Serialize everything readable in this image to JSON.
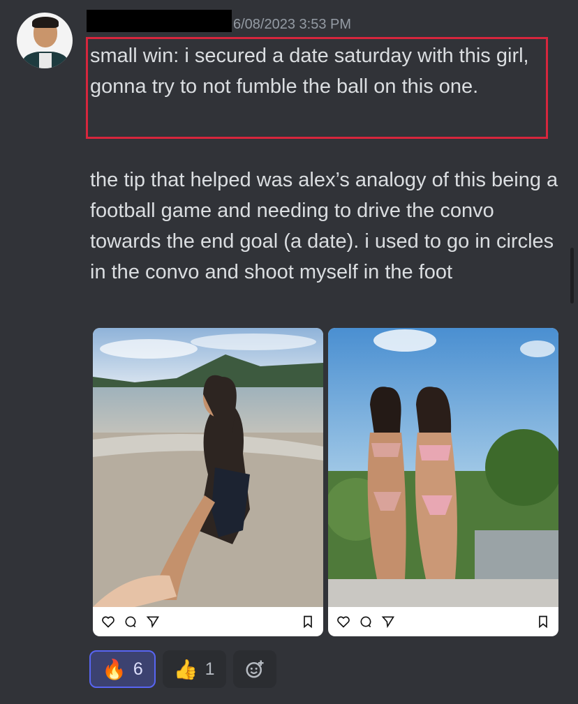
{
  "message": {
    "timestamp": "6/08/2023 3:53 PM",
    "highlighted_text": "small win: i secured a date saturday with this girl, gonna try to not fumble the ball on this one.",
    "body_text": "the tip that helped was alex’s analogy of this being a football game and needing to drive the convo towards the end goal (a date). i used to go in circles in the convo and shoot myself in the foot"
  },
  "attachments": [
    {
      "type": "instagram-post",
      "icons": [
        "heart-icon",
        "comment-icon",
        "share-icon",
        "bookmark-icon"
      ]
    },
    {
      "type": "instagram-post",
      "icons": [
        "heart-icon",
        "comment-icon",
        "share-icon",
        "bookmark-icon"
      ]
    }
  ],
  "reactions": [
    {
      "emoji": "🔥",
      "count": "6",
      "active": true
    },
    {
      "emoji": "👍",
      "count": "1",
      "active": false
    }
  ],
  "colors": {
    "background": "#313338",
    "text": "#dbdee1",
    "timestamp": "#949ba4",
    "highlight_border": "#d7263d",
    "active_reaction": "#5865f2"
  }
}
